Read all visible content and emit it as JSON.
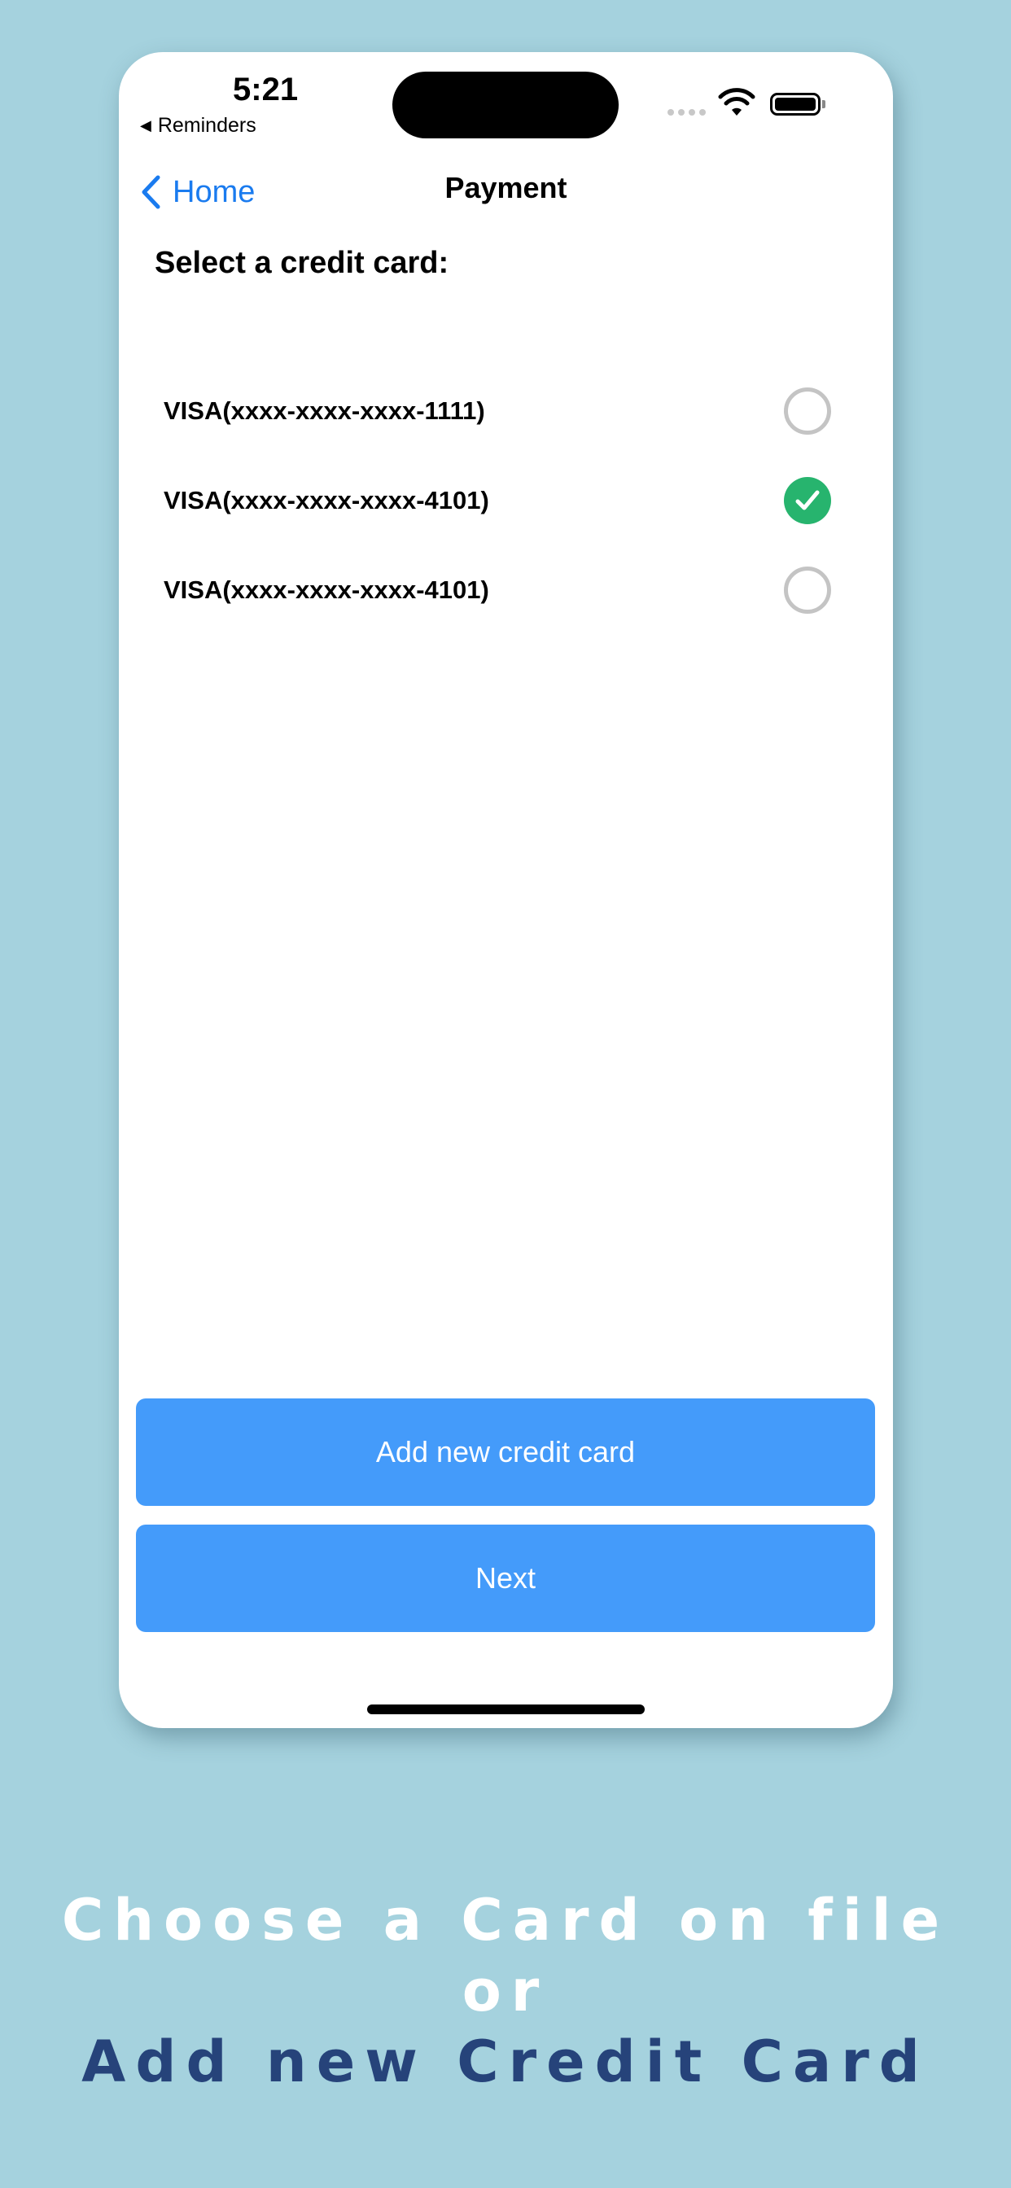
{
  "status_bar": {
    "time": "5:21",
    "back_app": "Reminders",
    "back_arrow": "◀"
  },
  "nav": {
    "back_label": "Home",
    "title": "Payment"
  },
  "section_title": "Select a credit card:",
  "cards": [
    {
      "label": "VISA(xxxx-xxxx-xxxx-1111)",
      "selected": false
    },
    {
      "label": "VISA(xxxx-xxxx-xxxx-4101)",
      "selected": true
    },
    {
      "label": "VISA(xxxx-xxxx-xxxx-4101)",
      "selected": false
    }
  ],
  "buttons": {
    "add_card": "Add new credit card",
    "next": "Next"
  },
  "caption": {
    "line1": "Choose a Card on file",
    "line2": "or",
    "line3": "Add new Credit Card"
  },
  "colors": {
    "background": "#a5d2de",
    "accent_blue": "#1a7bef",
    "button_blue": "#449bfa",
    "selected_green": "#27b46e",
    "caption_navy": "#26437a"
  },
  "icons": {
    "back": "chevron-left-icon",
    "selected": "checkmark-icon",
    "wifi": "wifi-icon",
    "battery": "battery-icon",
    "signal": "signal-icon"
  }
}
